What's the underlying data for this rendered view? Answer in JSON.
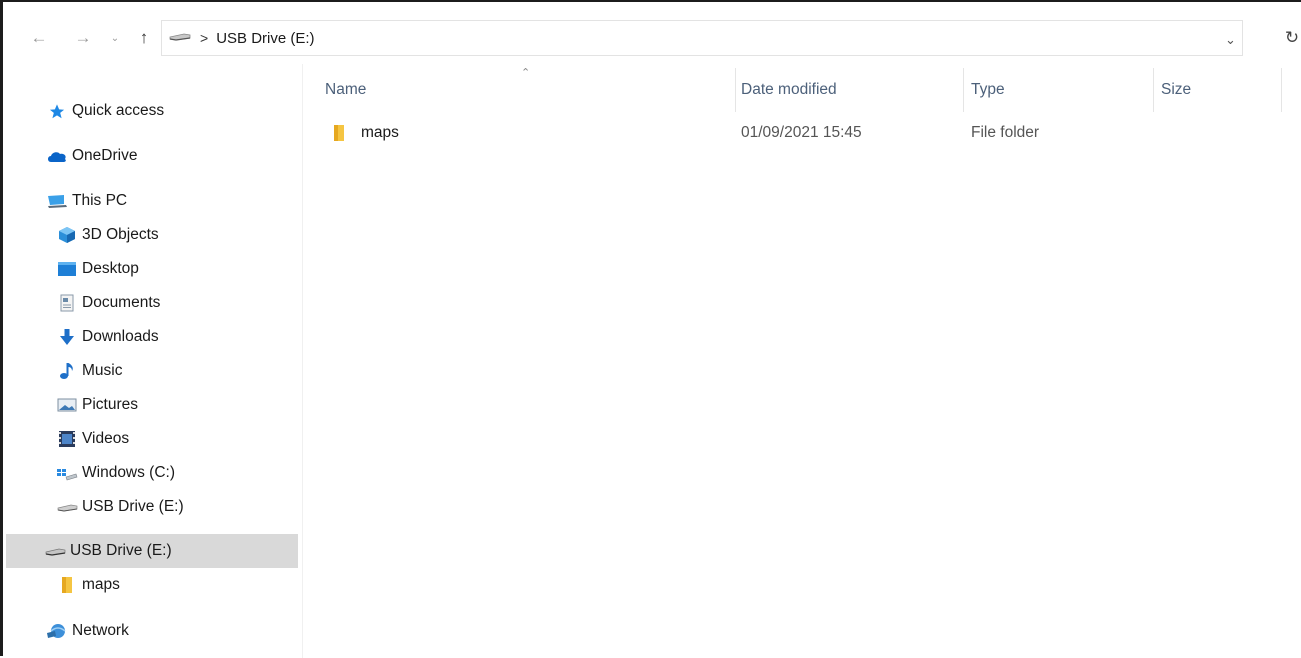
{
  "toolbar": {
    "back_icon": "arrow-left-icon",
    "forward_icon": "arrow-right-icon",
    "recent_icon": "chevron-down-icon",
    "up_icon": "arrow-up-icon",
    "refresh_icon": "refresh-icon"
  },
  "address": {
    "separator": ">",
    "current": "USB Drive (E:)"
  },
  "sidebar": {
    "items": [
      {
        "label": "Quick access",
        "icon": "star-icon"
      },
      {
        "label": "OneDrive",
        "icon": "cloud-icon"
      },
      {
        "label": "This PC",
        "icon": "computer-icon"
      },
      {
        "label": "3D Objects",
        "icon": "cube-icon"
      },
      {
        "label": "Desktop",
        "icon": "desktop-icon"
      },
      {
        "label": "Documents",
        "icon": "document-icon"
      },
      {
        "label": "Downloads",
        "icon": "download-icon"
      },
      {
        "label": "Music",
        "icon": "music-icon"
      },
      {
        "label": "Pictures",
        "icon": "pictures-icon"
      },
      {
        "label": "Videos",
        "icon": "videos-icon"
      },
      {
        "label": "Windows (C:)",
        "icon": "windows-drive-icon"
      },
      {
        "label": "USB Drive (E:)",
        "icon": "usb-drive-icon"
      },
      {
        "label": "USB Drive (E:)",
        "icon": "usb-drive-icon",
        "selected": true
      },
      {
        "label": "maps",
        "icon": "folder-icon"
      },
      {
        "label": "Network",
        "icon": "network-icon"
      }
    ]
  },
  "columns": {
    "name": "Name",
    "date": "Date modified",
    "type": "Type",
    "size": "Size"
  },
  "files": [
    {
      "name": "maps",
      "date": "01/09/2021 15:45",
      "type": "File folder",
      "size": ""
    }
  ],
  "colors": {
    "accent_blue": "#1e88e5",
    "folder_yellow": "#f5c542",
    "header_text": "#4c607a",
    "selected_bg": "#d9d9d9"
  }
}
